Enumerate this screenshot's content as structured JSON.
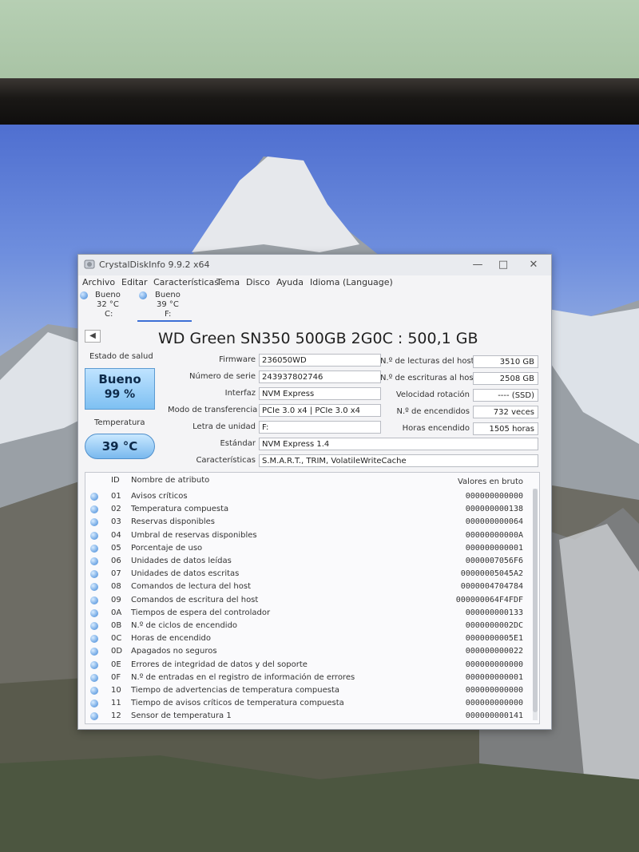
{
  "window": {
    "title": "CrystalDiskInfo 9.9.2 x64",
    "controls": {
      "minimize": "—",
      "maximize": "□",
      "close": "✕"
    }
  },
  "menu": [
    "Archivo",
    "Editar",
    "Características",
    "Tema",
    "Disco",
    "Ayuda",
    "Idioma (Language)"
  ],
  "drives": [
    {
      "status": "Bueno",
      "temp": "32 °C",
      "letter": "C:",
      "active": false
    },
    {
      "status": "Bueno",
      "temp": "39 °C",
      "letter": "F:",
      "active": true
    }
  ],
  "disk": {
    "title": "WD Green SN350 500GB 2G0C : 500,1 GB",
    "health_label": "Estado de salud",
    "health_status": "Bueno",
    "health_percent": "99 %",
    "temp_label": "Temperatura",
    "temperature": "39 °C"
  },
  "fields": {
    "firmware": {
      "label": "Firmware",
      "value": "236050WD"
    },
    "serial": {
      "label": "Número de serie",
      "value": "243937802746"
    },
    "interface": {
      "label": "Interfaz",
      "value": "NVM Express"
    },
    "transfer": {
      "label": "Modo de transferencia",
      "value": "PCIe 3.0 x4 | PCIe 3.0 x4"
    },
    "drive_letter": {
      "label": "Letra de unidad",
      "value": "F:"
    },
    "standard": {
      "label": "Estándar",
      "value": "NVM Express 1.4"
    },
    "features": {
      "label": "Características",
      "value": "S.M.A.R.T., TRIM, VolatileWriteCache"
    }
  },
  "right_fields": {
    "host_reads": {
      "label": "N.º de lecturas del host",
      "value": "3510 GB"
    },
    "host_writes": {
      "label": "N.º de escrituras al host",
      "value": "2508 GB"
    },
    "rotation": {
      "label": "Velocidad rotación",
      "value": "---- (SSD)"
    },
    "power_count": {
      "label": "N.º de encendidos",
      "value": "732 veces"
    },
    "power_hours": {
      "label": "Horas encendido",
      "value": "1505 horas"
    }
  },
  "attributes": {
    "headers": {
      "id": "ID",
      "name": "Nombre de atributo",
      "raw": "Valores en bruto"
    },
    "rows": [
      {
        "id": "01",
        "name": "Avisos críticos",
        "raw": "000000000000"
      },
      {
        "id": "02",
        "name": "Temperatura compuesta",
        "raw": "000000000138"
      },
      {
        "id": "03",
        "name": "Reservas disponibles",
        "raw": "000000000064"
      },
      {
        "id": "04",
        "name": "Umbral de reservas disponibles",
        "raw": "00000000000A"
      },
      {
        "id": "05",
        "name": "Porcentaje de uso",
        "raw": "000000000001"
      },
      {
        "id": "06",
        "name": "Unidades de datos leídas",
        "raw": "0000007056F6"
      },
      {
        "id": "07",
        "name": "Unidades de datos escritas",
        "raw": "00000005045A2"
      },
      {
        "id": "08",
        "name": "Comandos de lectura del host",
        "raw": "0000004704784"
      },
      {
        "id": "09",
        "name": "Comandos de escritura del host",
        "raw": "000000064F4FDF"
      },
      {
        "id": "0A",
        "name": "Tiempos de espera del controlador",
        "raw": "000000000133"
      },
      {
        "id": "0B",
        "name": "N.º de ciclos de encendido",
        "raw": "0000000002DC"
      },
      {
        "id": "0C",
        "name": "Horas de encendido",
        "raw": "0000000005E1"
      },
      {
        "id": "0D",
        "name": "Apagados no seguros",
        "raw": "000000000022"
      },
      {
        "id": "0E",
        "name": "Errores de integridad de datos y del soporte",
        "raw": "000000000000"
      },
      {
        "id": "0F",
        "name": "N.º de entradas en el registro de información de errores",
        "raw": "000000000001"
      },
      {
        "id": "10",
        "name": "Tiempo de advertencias de temperatura compuesta",
        "raw": "000000000000"
      },
      {
        "id": "11",
        "name": "Tiempo de avisos críticos de temperatura compuesta",
        "raw": "000000000000"
      },
      {
        "id": "12",
        "name": "Sensor de temperatura 1",
        "raw": "000000000141"
      }
    ]
  },
  "colors": {
    "health_good": "#7ec0f2",
    "attribute_dot": "#3d85d7",
    "active_tab": "#3c6fd6"
  },
  "icons": {
    "app": "disk-icon",
    "drive_status": "blue-circle-icon",
    "nav": "previous-arrow-icon"
  }
}
